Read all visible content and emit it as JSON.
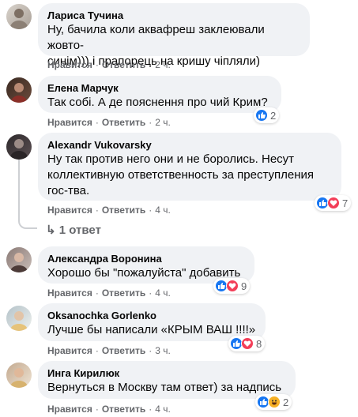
{
  "colors": {
    "bubble": "#f0f2f5",
    "like": "#1877f2",
    "love": "#f33e58",
    "haha": "#f7b125",
    "meta": "#65676b"
  },
  "comments": [
    {
      "name": "Лариса Тучина",
      "text": "Ну, бачила коли аквафреш заклеювали жовто-\nсинім))) і прапорець на кришу чіпляли)",
      "like": "Нравится",
      "reply": "Ответить",
      "time": "2 ч.",
      "reactions": [],
      "count": ""
    },
    {
      "name": "Елена Марчук",
      "text": "Так собі. А де пояснення про чий Крим?",
      "like": "Нравится",
      "reply": "Ответить",
      "time": "2 ч.",
      "reactions": [
        "like-icon"
      ],
      "count": "2"
    },
    {
      "name": "Alexandr Vukovarsky",
      "text": "Ну так против него они и не боролись. Несут\nколлективную ответственность за преступления\nгос-тва.",
      "like": "Нравится",
      "reply": "Ответить",
      "time": "4 ч.",
      "reactions": [
        "like-icon",
        "love-icon"
      ],
      "count": "7"
    },
    {
      "name": "Александра Воронина",
      "text": "Хорошо бы \"пожалуйста\" добавить",
      "like": "Нравится",
      "reply": "Ответить",
      "time": "4 ч.",
      "reactions": [
        "like-icon",
        "love-icon"
      ],
      "count": "9"
    },
    {
      "name": "Oksanochka Gorlenko",
      "text": "Лучше бы написали «КРЫМ ВАШ !!!!»",
      "like": "Нравится",
      "reply": "Ответить",
      "time": "3 ч.",
      "reactions": [
        "like-icon",
        "love-icon"
      ],
      "count": "8"
    },
    {
      "name": "Инга Кирилюк",
      "text": "Вернуться в Москву там ответ) за надпись",
      "like": "Нравится",
      "reply": "Ответить",
      "time": "4 ч.",
      "reactions": [
        "like-icon",
        "haha-icon"
      ],
      "count": "2"
    }
  ],
  "replies_link": "1 ответ"
}
